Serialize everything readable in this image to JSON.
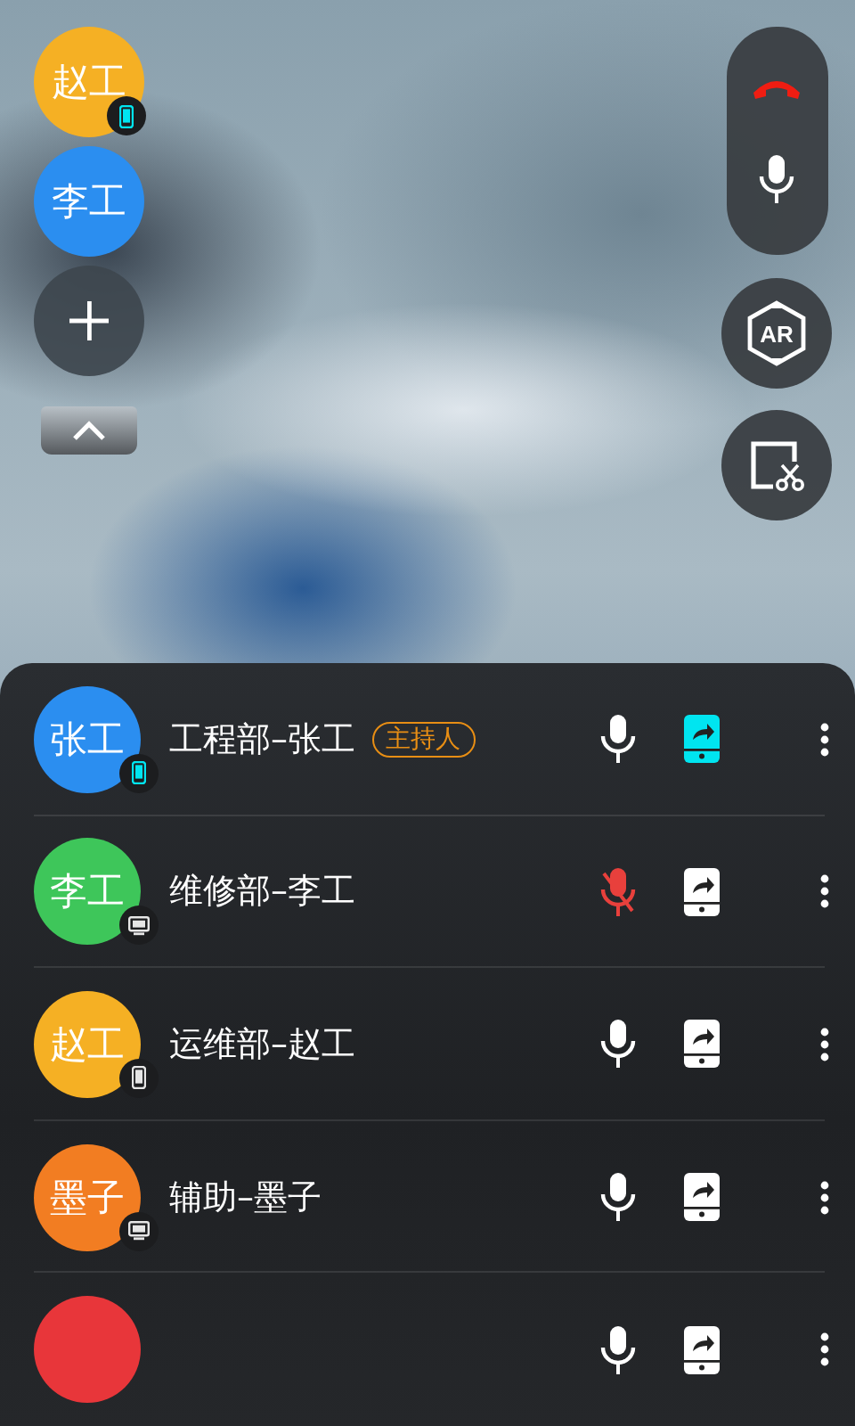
{
  "floating_participants": [
    {
      "avatar_text": "赵工",
      "color": "#f5b024",
      "device": {
        "kind": "phone",
        "active": true
      }
    },
    {
      "avatar_text": "李工",
      "color": "#2b8ef0"
    }
  ],
  "ar_button": {
    "label": "AR"
  },
  "participants": [
    {
      "avatar_text": "张工",
      "color": "#2b8ef0",
      "device": {
        "kind": "phone",
        "active": true
      },
      "name": "工程部–张工",
      "role_tag": "主持人",
      "muted": false,
      "sharing": true
    },
    {
      "avatar_text": "李工",
      "color": "#3ec65a",
      "device": {
        "kind": "pc",
        "active": false
      },
      "name": "维修部–李工",
      "muted": true,
      "sharing": false
    },
    {
      "avatar_text": "赵工",
      "color": "#f5b024",
      "device": {
        "kind": "phone",
        "active": false
      },
      "name": "运维部–赵工",
      "muted": false,
      "sharing": false
    },
    {
      "avatar_text": "墨子",
      "color": "#f27d22",
      "device": {
        "kind": "pc",
        "active": false
      },
      "name": "辅助–墨子",
      "muted": false,
      "sharing": false
    },
    {
      "color": "#e8363a",
      "muted": false,
      "sharing": false
    }
  ]
}
